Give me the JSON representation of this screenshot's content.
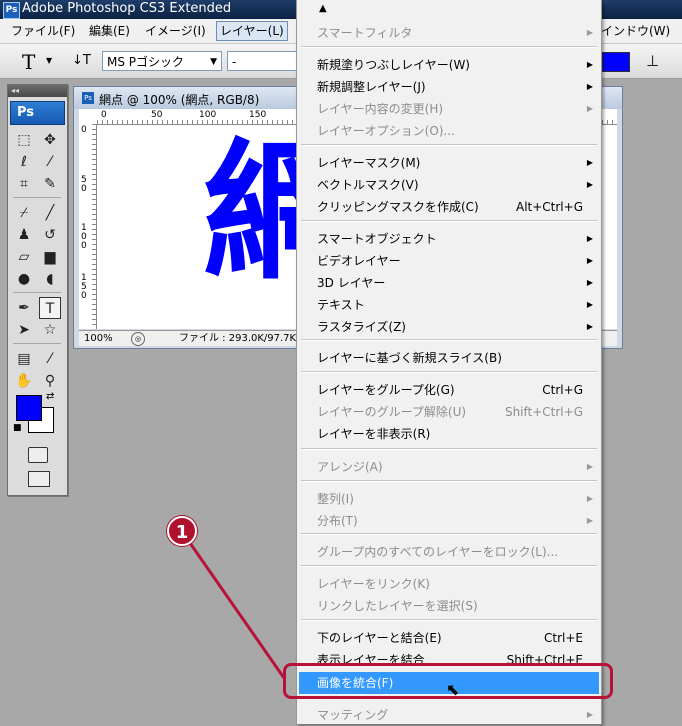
{
  "window": {
    "app_icon": "Ps",
    "title": "Adobe Photoshop CS3 Extended"
  },
  "menubar": {
    "items": [
      {
        "label": "ファイル(F)"
      },
      {
        "label": "編集(E)"
      },
      {
        "label": "イメージ(I)"
      },
      {
        "label": "レイヤー(L)"
      },
      {
        "label": "インドウ(W)"
      }
    ]
  },
  "options": {
    "tool_icon": "T",
    "font_family": "MS Pゴシック",
    "font_style": "-",
    "text_color": "#0000ff"
  },
  "toolbox": {
    "badge": "Ps",
    "foreground": "#0000ff",
    "background": "#ffffff"
  },
  "document": {
    "title": "網点 @ 100% (網点, RGB/8)",
    "ruler_top": [
      "0",
      "50",
      "100",
      "150"
    ],
    "ruler_left": [
      "0",
      "5\n0",
      "1\n0\n0",
      "1\n5\n0"
    ],
    "canvas_text": "網",
    "zoom": "100%",
    "file_info": "ファイル : 293.0K/97.7K"
  },
  "dropdown": {
    "scroll_up": "▲",
    "items": [
      {
        "label": "スマートフィルタ",
        "shortcut": "",
        "submenu": true,
        "disabled": true
      },
      {
        "label": "新規塗りつぶしレイヤー(W)",
        "shortcut": "",
        "submenu": true,
        "disabled": false
      },
      {
        "label": "新規調整レイヤー(J)",
        "shortcut": "",
        "submenu": true,
        "disabled": false
      },
      {
        "label": "レイヤー内容の変更(H)",
        "shortcut": "",
        "submenu": true,
        "disabled": true
      },
      {
        "label": "レイヤーオプション(O)...",
        "shortcut": "",
        "submenu": false,
        "disabled": true
      },
      {
        "label": "レイヤーマスク(M)",
        "shortcut": "",
        "submenu": true,
        "disabled": false
      },
      {
        "label": "ベクトルマスク(V)",
        "shortcut": "",
        "submenu": true,
        "disabled": false
      },
      {
        "label": "クリッピングマスクを作成(C)",
        "shortcut": "Alt+Ctrl+G",
        "submenu": false,
        "disabled": false
      },
      {
        "label": "スマートオブジェクト",
        "shortcut": "",
        "submenu": true,
        "disabled": false
      },
      {
        "label": "ビデオレイヤー",
        "shortcut": "",
        "submenu": true,
        "disabled": false
      },
      {
        "label": "3D レイヤー",
        "shortcut": "",
        "submenu": true,
        "disabled": false
      },
      {
        "label": "テキスト",
        "shortcut": "",
        "submenu": true,
        "disabled": false
      },
      {
        "label": "ラスタライズ(Z)",
        "shortcut": "",
        "submenu": true,
        "disabled": false
      },
      {
        "label": "レイヤーに基づく新規スライス(B)",
        "shortcut": "",
        "submenu": false,
        "disabled": false
      },
      {
        "label": "レイヤーをグループ化(G)",
        "shortcut": "Ctrl+G",
        "submenu": false,
        "disabled": false
      },
      {
        "label": "レイヤーのグループ解除(U)",
        "shortcut": "Shift+Ctrl+G",
        "submenu": false,
        "disabled": true
      },
      {
        "label": "レイヤーを非表示(R)",
        "shortcut": "",
        "submenu": false,
        "disabled": false
      },
      {
        "label": "アレンジ(A)",
        "shortcut": "",
        "submenu": true,
        "disabled": true
      },
      {
        "label": "整列(I)",
        "shortcut": "",
        "submenu": true,
        "disabled": true
      },
      {
        "label": "分布(T)",
        "shortcut": "",
        "submenu": true,
        "disabled": true
      },
      {
        "label": "グループ内のすべてのレイヤーをロック(L)...",
        "shortcut": "",
        "submenu": false,
        "disabled": true
      },
      {
        "label": "レイヤーをリンク(K)",
        "shortcut": "",
        "submenu": false,
        "disabled": true
      },
      {
        "label": "リンクしたレイヤーを選択(S)",
        "shortcut": "",
        "submenu": false,
        "disabled": true
      },
      {
        "label": "下のレイヤーと結合(E)",
        "shortcut": "Ctrl+E",
        "submenu": false,
        "disabled": false
      },
      {
        "label": "表示レイヤーを結合",
        "shortcut": "Shift+Ctrl+E",
        "submenu": false,
        "disabled": false
      },
      {
        "label": "画像を統合(F)",
        "shortcut": "",
        "submenu": false,
        "disabled": false,
        "highlighted": true
      },
      {
        "label": "マッティング",
        "shortcut": "",
        "submenu": true,
        "disabled": true
      }
    ]
  },
  "annotation": {
    "marker": "1",
    "color": "#b7123a"
  }
}
